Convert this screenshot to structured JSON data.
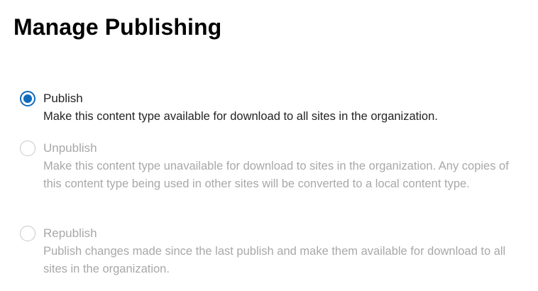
{
  "page": {
    "title": "Manage Publishing"
  },
  "options": [
    {
      "label": "Publish",
      "description": "Make this content type available for download to all sites in the organization.",
      "selected": true,
      "enabled": true
    },
    {
      "label": "Unpublish",
      "description": "Make this content type unavailable for download to sites in the organization. Any copies of this content type being used in other sites will be converted to a local content type.",
      "selected": false,
      "enabled": false
    },
    {
      "label": "Republish",
      "description": "Publish changes made since the last publish and make them available for download to all sites in the organization.",
      "selected": false,
      "enabled": false
    }
  ],
  "colors": {
    "accent": "#0f6cbd",
    "text": "#242424",
    "disabled_text": "#a8a8a8"
  }
}
